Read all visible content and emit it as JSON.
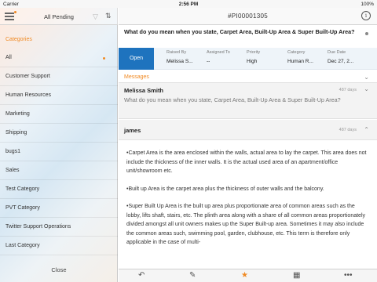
{
  "status_bar": {
    "carrier": "Carrier",
    "time": "2:56 PM",
    "battery": "100%"
  },
  "sidebar": {
    "title": "All Pending",
    "categories_header": "Categories",
    "items": [
      {
        "label": "All",
        "selected": true
      },
      {
        "label": "Customer Support"
      },
      {
        "label": "Human Resources"
      },
      {
        "label": "Marketing"
      },
      {
        "label": "Shipping"
      },
      {
        "label": "bugs1"
      },
      {
        "label": "Sales"
      },
      {
        "label": "Test Category"
      },
      {
        "label": "PVT Category"
      },
      {
        "label": "Twitter Support Operations"
      },
      {
        "label": "Last Category"
      }
    ],
    "close_label": "Close"
  },
  "ticket": {
    "id": "#PI00001305",
    "subject": "What do you mean when you state, Carpet Area, Built-Up Area & Super Built-Up Area?",
    "status": "Open",
    "meta": [
      {
        "label": "Raised By",
        "value": "Melissa S..."
      },
      {
        "label": "Assigned To",
        "value": "--"
      },
      {
        "label": "Priority",
        "value": "High"
      },
      {
        "label": "Category",
        "value": "Human R..."
      },
      {
        "label": "Due Date",
        "value": "Dec 27, 2..."
      }
    ]
  },
  "messages": {
    "header": "Messages",
    "items": [
      {
        "author": "Melissa Smith",
        "age": "487 days",
        "text": "What do you mean when you state, Carpet Area, Built-Up Area & Super Built-Up Area?"
      },
      {
        "author": "james",
        "age": "487 days",
        "paragraphs": [
          "•Carpet Area is the area enclosed within the walls, actual area to lay the carpet. This area does not include the thickness of the inner walls. It is the actual used area of an apartment/office unit/showroom etc.",
          "•Built up Area is the carpet area plus the thickness of outer walls and the balcony.",
          "•Super Built Up Area is the built up area plus proportionate area of common areas such as the lobby, lifts shaft, stairs, etc. The plinth area along with a share of all common areas proportionately divided amongst all unit owners makes up the Super Built-up area. Sometimes it may also include the common areas such, swimming pool, garden, clubhouse, etc. This term is therefore only applicable in the case of multi-"
        ]
      }
    ]
  },
  "bottom_bar": {
    "icons": [
      "reply-icon",
      "edit-icon",
      "star-icon",
      "calendar-icon",
      "more-icon"
    ]
  },
  "colors": {
    "accent": "#f08a24",
    "status_open": "#1e73be"
  }
}
